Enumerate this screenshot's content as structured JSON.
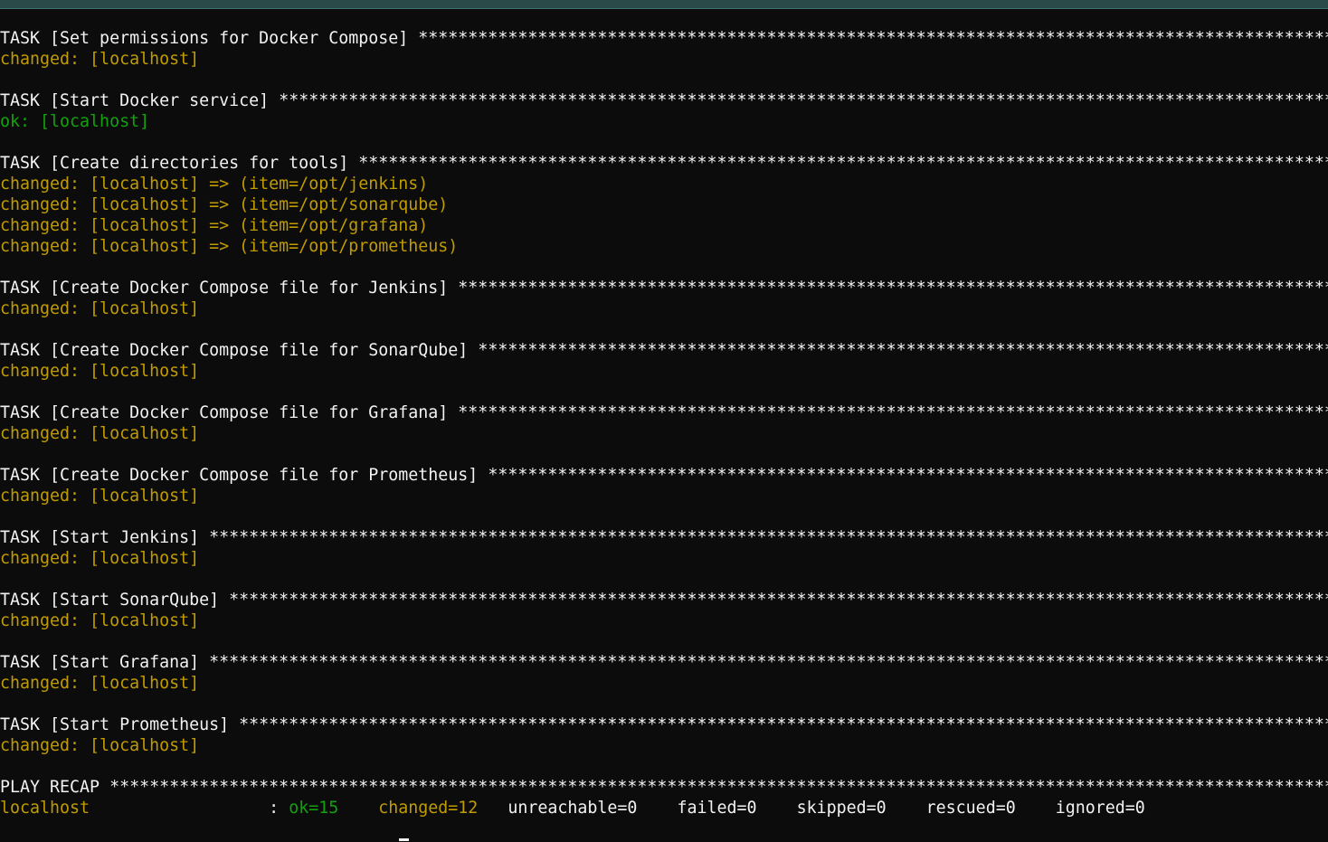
{
  "terminal": {
    "stars": "**************************************************************************************************************************************************************************",
    "lines": [
      {
        "type": "task",
        "text": "TASK [Set permissions for Docker Compose] "
      },
      {
        "type": "changed",
        "text": "changed: [localhost]"
      },
      {
        "type": "blank",
        "text": ""
      },
      {
        "type": "task",
        "text": "TASK [Start Docker service] "
      },
      {
        "type": "ok",
        "text": "ok: [localhost]"
      },
      {
        "type": "blank",
        "text": ""
      },
      {
        "type": "task",
        "text": "TASK [Create directories for tools] "
      },
      {
        "type": "changed",
        "text": "changed: [localhost] => (item=/opt/jenkins)"
      },
      {
        "type": "changed",
        "text": "changed: [localhost] => (item=/opt/sonarqube)"
      },
      {
        "type": "changed",
        "text": "changed: [localhost] => (item=/opt/grafana)"
      },
      {
        "type": "changed",
        "text": "changed: [localhost] => (item=/opt/prometheus)"
      },
      {
        "type": "blank",
        "text": ""
      },
      {
        "type": "task",
        "text": "TASK [Create Docker Compose file for Jenkins] "
      },
      {
        "type": "changed",
        "text": "changed: [localhost]"
      },
      {
        "type": "blank",
        "text": ""
      },
      {
        "type": "task",
        "text": "TASK [Create Docker Compose file for SonarQube] "
      },
      {
        "type": "changed",
        "text": "changed: [localhost]"
      },
      {
        "type": "blank",
        "text": ""
      },
      {
        "type": "task",
        "text": "TASK [Create Docker Compose file for Grafana] "
      },
      {
        "type": "changed",
        "text": "changed: [localhost]"
      },
      {
        "type": "blank",
        "text": ""
      },
      {
        "type": "task",
        "text": "TASK [Create Docker Compose file for Prometheus] "
      },
      {
        "type": "changed",
        "text": "changed: [localhost]"
      },
      {
        "type": "blank",
        "text": ""
      },
      {
        "type": "task",
        "text": "TASK [Start Jenkins] "
      },
      {
        "type": "changed",
        "text": "changed: [localhost]"
      },
      {
        "type": "blank",
        "text": ""
      },
      {
        "type": "task",
        "text": "TASK [Start SonarQube] "
      },
      {
        "type": "changed",
        "text": "changed: [localhost]"
      },
      {
        "type": "blank",
        "text": ""
      },
      {
        "type": "task",
        "text": "TASK [Start Grafana] "
      },
      {
        "type": "changed",
        "text": "changed: [localhost]"
      },
      {
        "type": "blank",
        "text": ""
      },
      {
        "type": "task",
        "text": "TASK [Start Prometheus] "
      },
      {
        "type": "changed",
        "text": "changed: [localhost]"
      },
      {
        "type": "blank",
        "text": ""
      },
      {
        "type": "task",
        "text": "PLAY RECAP "
      }
    ],
    "recap": {
      "host": "localhost",
      "sep": "                  : ",
      "ok": "ok=15",
      "gap1": "    ",
      "changed": "changed=12",
      "gap2": "   ",
      "unreachable": "unreachable=0",
      "gap3": "    ",
      "failed": "failed=0",
      "gap4": "    ",
      "skipped": "skipped=0",
      "gap5": "    ",
      "rescued": "rescued=0",
      "gap6": "    ",
      "ignored": "ignored=0"
    }
  },
  "colors": {
    "background": "#0c0c0c",
    "task_text": "#f2f2f2",
    "changed_text": "#c19c00",
    "ok_text": "#13a10e"
  }
}
